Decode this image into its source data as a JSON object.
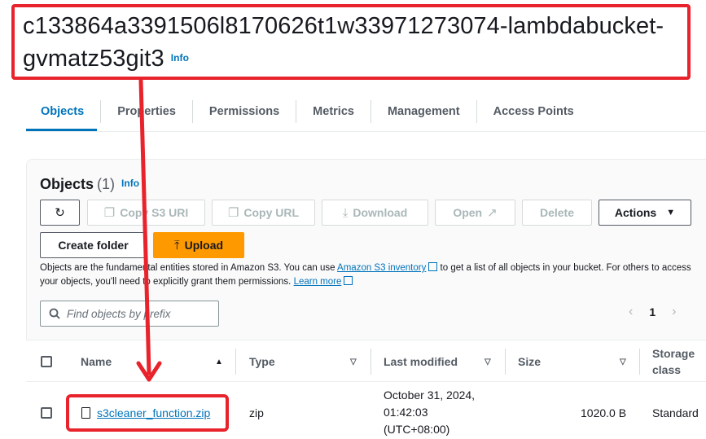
{
  "bucket": {
    "name": "c133864a3391506l8170626t1w33971273074-lambdabucket-gvmatz53git3",
    "info_label": "Info"
  },
  "tabs": [
    {
      "label": "Objects",
      "active": true
    },
    {
      "label": "Properties"
    },
    {
      "label": "Permissions"
    },
    {
      "label": "Metrics"
    },
    {
      "label": "Management"
    },
    {
      "label": "Access Points"
    }
  ],
  "objects_panel": {
    "title": "Objects",
    "count": "(1)",
    "info_label": "Info"
  },
  "toolbar": {
    "refresh_icon": "refresh-icon",
    "copy_s3_uri": "Copy S3 URI",
    "copy_url": "Copy URL",
    "download": "Download",
    "open": "Open",
    "delete": "Delete",
    "actions": "Actions",
    "create_folder": "Create folder",
    "upload": "Upload"
  },
  "description": {
    "part1": "Objects are the fundamental entities stored in Amazon S3. You can use ",
    "inventory_link": "Amazon S3 inventory",
    "part2": " to get a list of all objects in your bucket. For others to access your objects, you'll need to explicitly grant them permissions. ",
    "learn_more": "Learn more"
  },
  "search": {
    "placeholder": "Find objects by prefix"
  },
  "pagination": {
    "current_page": "1"
  },
  "table": {
    "columns": {
      "name": "Name",
      "type": "Type",
      "last_modified": "Last modified",
      "size": "Size",
      "storage_class_line1": "Storage",
      "storage_class_line2": "class"
    },
    "rows": [
      {
        "name": "s3cleaner_function.zip",
        "type": "zip",
        "last_modified_line1": "October 31, 2024,",
        "last_modified_line2": "01:42:03",
        "last_modified_line3": "(UTC+08:00)",
        "size": "1020.0 B",
        "storage_class": "Standard"
      }
    ]
  },
  "colors": {
    "accent": "#0073bb",
    "upload": "#ff9900",
    "highlight": "#e8232b"
  }
}
